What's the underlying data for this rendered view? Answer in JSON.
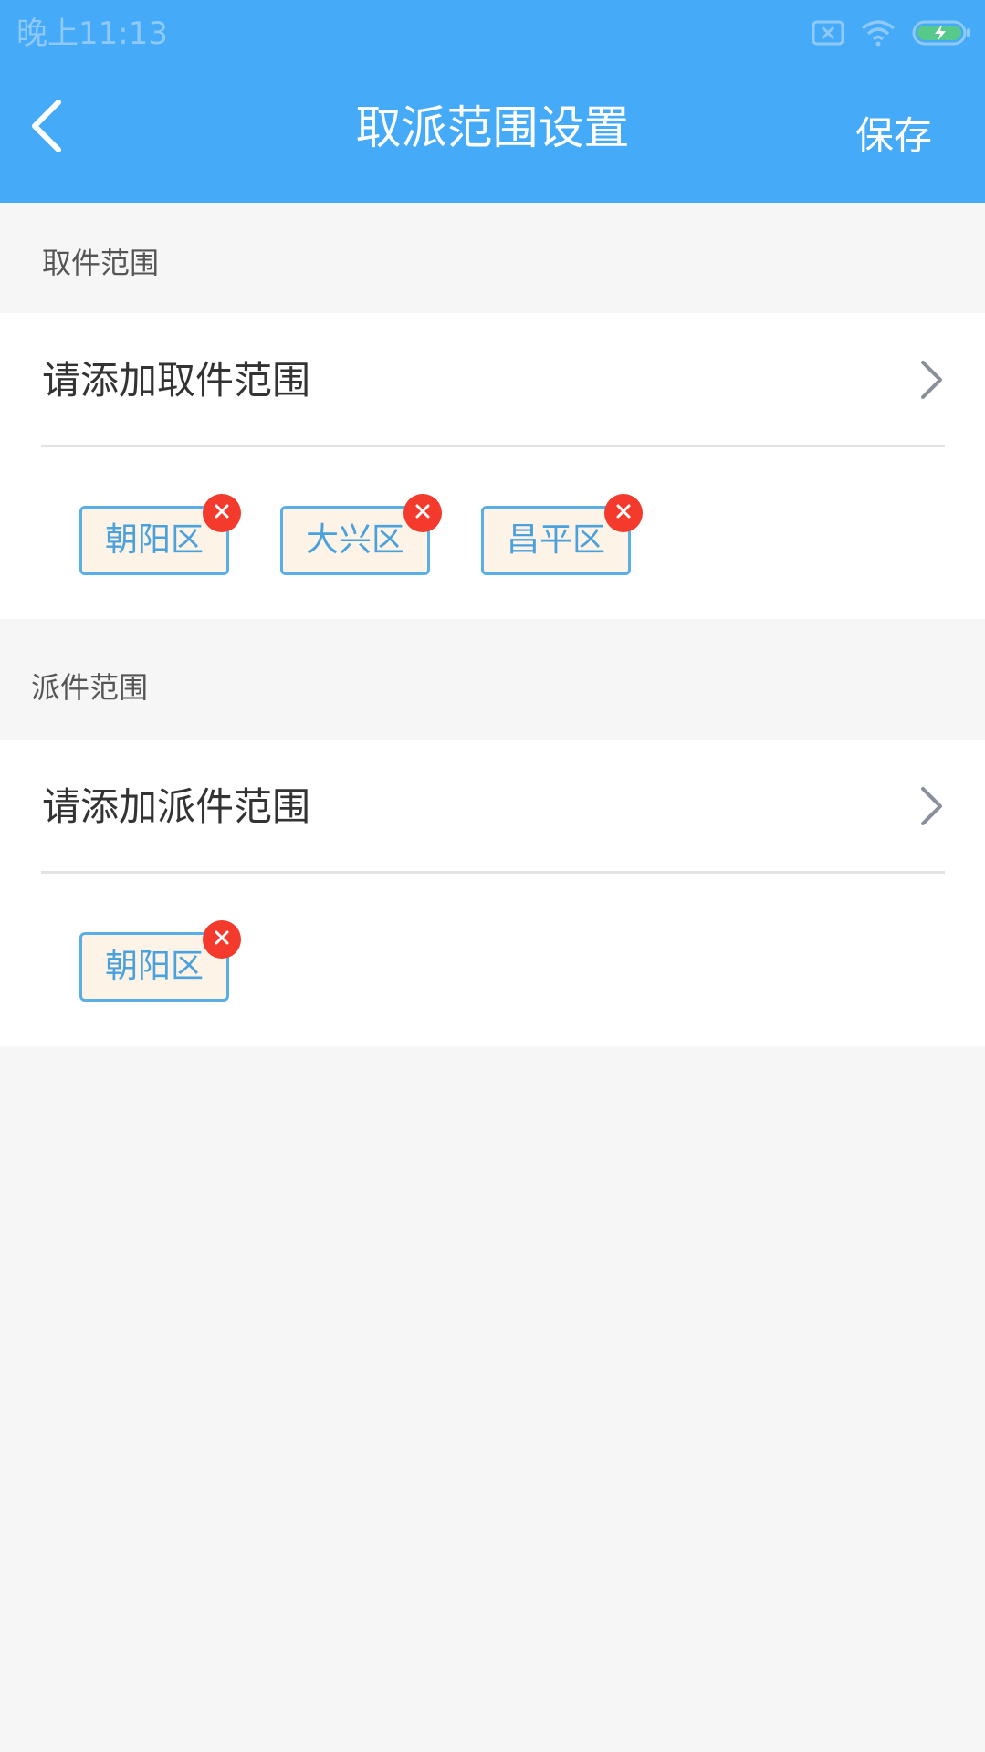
{
  "status_bar": {
    "time": "晚上11:13",
    "icons": [
      "sim-card-x-icon",
      "wifi-icon",
      "battery-charging-icon"
    ]
  },
  "header": {
    "back_icon": "chevron-left-icon",
    "title": "取派范围设置",
    "save_label": "保存"
  },
  "pickup": {
    "section_label": "取件范围",
    "add_label": "请添加取件范围",
    "tags": [
      "朝阳区",
      "大兴区",
      "昌平区"
    ]
  },
  "delivery": {
    "section_label": "派件范围",
    "add_label": "请添加派件范围",
    "tags": [
      "朝阳区"
    ]
  },
  "colors": {
    "header_bg": "#45aaf8",
    "tag_border": "#5aaee6",
    "tag_bg": "#fdf3e6",
    "tag_text": "#4aa1dc",
    "remove_badge": "#f33a2d"
  }
}
